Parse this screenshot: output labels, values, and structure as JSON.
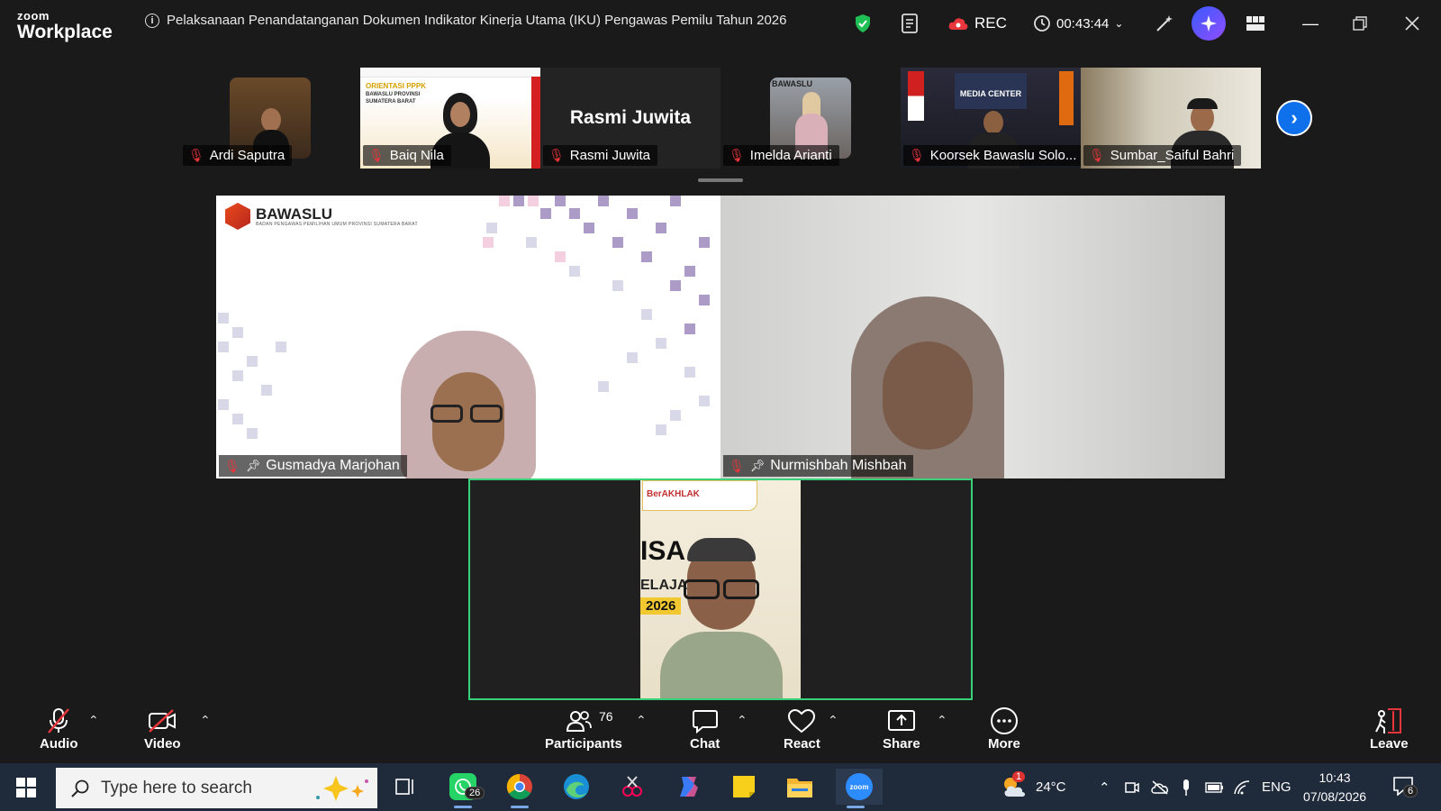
{
  "app": {
    "brand_line1": "zoom",
    "brand_line2": "Workplace"
  },
  "meeting": {
    "title": "Pelaksanaan Penandatanganan Dokumen Indikator Kinerja Utama (IKU) Pengawas Pemilu Tahun 2026",
    "rec_label": "REC",
    "timer": "00:43:44"
  },
  "colors": {
    "accent": "#0e71eb",
    "active_speaker_border": "#37d17a",
    "muted_mic": "#e8363c"
  },
  "gallery_strip": {
    "participants": [
      {
        "name": "Ardi Saputra",
        "muted": true
      },
      {
        "name": "Baiq Nila",
        "muted": true,
        "slide_line1": "ORIENTASI PPPK",
        "slide_line2": "BAWASLU PROVINSI",
        "slide_line3": "SUMATERA BARAT"
      },
      {
        "name": "Rasmi Juwita",
        "muted": true,
        "video_off_label": "Rasmi Juwita"
      },
      {
        "name": "Imelda Arianti",
        "muted": true,
        "backdrop_text": "BAWASLU"
      },
      {
        "name": "Koorsek Bawaslu Solo...",
        "muted": true,
        "backdrop_text": "MEDIA CENTER"
      },
      {
        "name": "Sumbar_Saiful Bahri",
        "muted": true
      }
    ]
  },
  "main_tiles": {
    "left": {
      "name": "Gusmadya Marjohan",
      "muted": true,
      "pinned": true,
      "logo_text": "BAWASLU",
      "logo_sub": "BADAN PENGAWAS PEMILIHAN UMUM PROVINSI SUMATERA BARAT"
    },
    "right": {
      "name": "Nurmishbah Mishbah",
      "muted": true,
      "pinned": true
    },
    "speaker": {
      "banner_text": "BerAKHLAK",
      "bg_line1": "ISA",
      "bg_line2": "ELAJA",
      "bg_year": "2026"
    }
  },
  "toolbar": {
    "audio": "Audio",
    "video": "Video",
    "participants": "Participants",
    "participants_count": "76",
    "chat": "Chat",
    "react": "React",
    "share": "Share",
    "more": "More",
    "leave": "Leave"
  },
  "taskbar": {
    "search_placeholder": "Type here to search",
    "whatsapp_badge": "26",
    "temperature": "24°C",
    "weather_badge": "1",
    "language": "ENG",
    "time": "10:43",
    "date": "07/08/2026",
    "notification_count": "6"
  }
}
